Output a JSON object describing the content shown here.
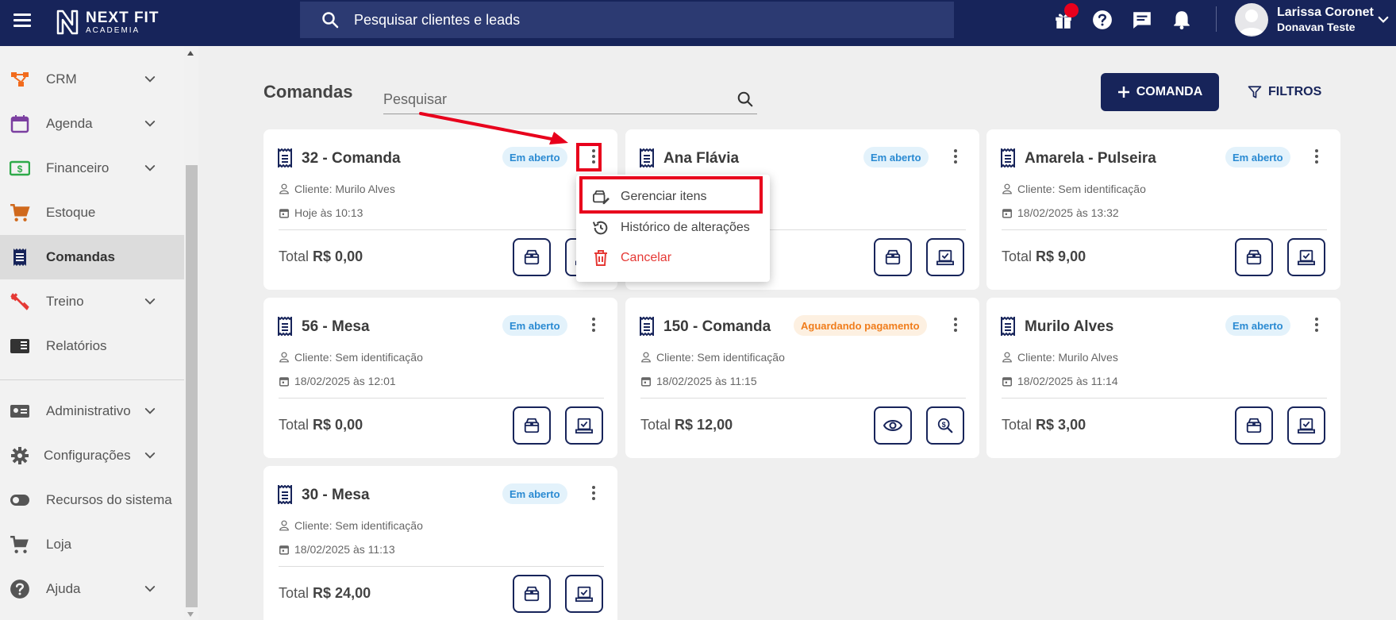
{
  "app": {
    "logo_main": "NEXT FIT",
    "logo_sub": "ACADEMIA",
    "search_placeholder": "Pesquisar clientes e leads",
    "user_name": "Larissa Coronet",
    "user_sub": "Donavan Teste"
  },
  "sidebar": {
    "items": [
      {
        "label": "CRM",
        "icon": "crm-icon",
        "color": "#f26b1d"
      },
      {
        "label": "Agenda",
        "icon": "calendar-icon",
        "color": "#7b3fa0"
      },
      {
        "label": "Financeiro",
        "icon": "money-icon",
        "color": "#2eaa4a"
      },
      {
        "label": "Estoque",
        "icon": "cart-icon",
        "color": "#d0691c"
      },
      {
        "label": "Comandas",
        "icon": "receipt-icon",
        "color": "#17245a"
      },
      {
        "label": "Treino",
        "icon": "dumbbell-icon",
        "color": "#e53935"
      },
      {
        "label": "Relatórios",
        "icon": "reports-icon",
        "color": "#333333"
      },
      {
        "label": "Administrativo",
        "icon": "id-card-icon",
        "color": "#555555"
      },
      {
        "label": "Configurações",
        "icon": "gear-icon",
        "color": "#555555"
      },
      {
        "label": "Recursos do sistema",
        "icon": "toggle-icon",
        "color": "#555555"
      },
      {
        "label": "Loja",
        "icon": "cart-icon",
        "color": "#555555"
      },
      {
        "label": "Ajuda",
        "icon": "help-icon",
        "color": "#555555"
      }
    ]
  },
  "main": {
    "title": "Comandas",
    "search_placeholder": "Pesquisar",
    "add_button": "COMANDA",
    "filter_button": "FILTROS"
  },
  "cards": [
    {
      "title": "32 - Comanda",
      "status": "Em aberto",
      "client": "Cliente: Murilo Alves",
      "date": "Hoje às 10:13",
      "total_label": "Total",
      "total": "R$ 0,00"
    },
    {
      "title": "Ana Flávia",
      "status": "Em aberto",
      "client": "",
      "date": "",
      "total_label": "",
      "total": ""
    },
    {
      "title": "Amarela - Pulseira",
      "status": "Em aberto",
      "client": "Cliente: Sem identificação",
      "date": "18/02/2025 às 13:32",
      "total_label": "Total",
      "total": "R$ 9,00"
    },
    {
      "title": "56 - Mesa",
      "status": "Em aberto",
      "client": "Cliente: Sem identificação",
      "date": "18/02/2025 às 12:01",
      "total_label": "Total",
      "total": "R$ 0,00"
    },
    {
      "title": "150 - Comanda",
      "status": "Aguardando pagamento",
      "client": "Cliente: Sem identificação",
      "date": "18/02/2025 às 11:15",
      "total_label": "Total",
      "total": "R$ 12,00"
    },
    {
      "title": "Murilo Alves",
      "status": "Em aberto",
      "client": "Cliente: Murilo Alves",
      "date": "18/02/2025 às 11:14",
      "total_label": "Total",
      "total": "R$ 3,00"
    },
    {
      "title": "30 - Mesa",
      "status": "Em aberto",
      "client": "Cliente: Sem identificação",
      "date": "18/02/2025 às 11:13",
      "total_label": "Total",
      "total": "R$ 24,00"
    }
  ],
  "menu": {
    "items": [
      {
        "label": "Gerenciar itens",
        "icon": "cart-edit-icon"
      },
      {
        "label": "Histórico de alterações",
        "icon": "history-icon"
      },
      {
        "label": "Cancelar",
        "icon": "trash-icon"
      }
    ]
  },
  "colors": {
    "primary": "#17245a",
    "open_badge": "#2a8ad2",
    "wait_badge": "#f07d1c",
    "danger": "#e53935",
    "annotation": "#e8001c"
  }
}
